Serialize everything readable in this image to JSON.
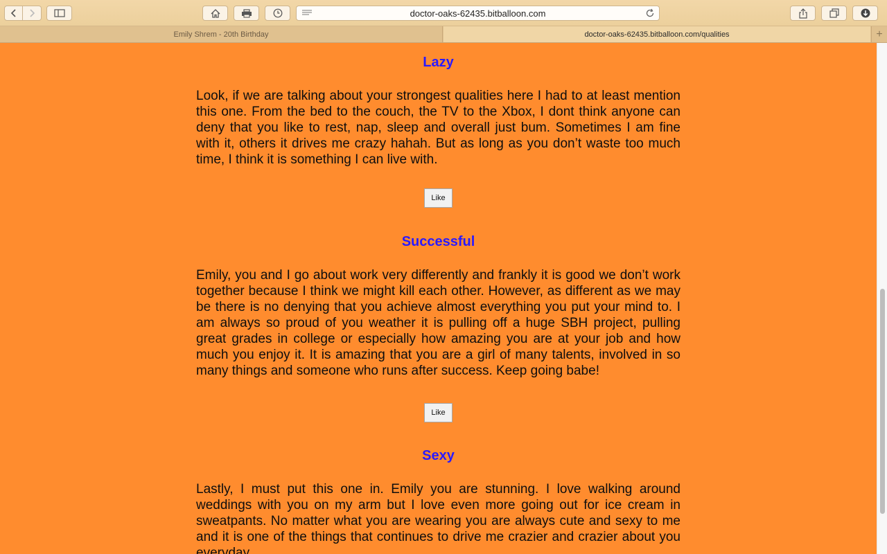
{
  "browser": {
    "url": "doctor-oaks-62435.bitballoon.com",
    "tabs": [
      {
        "label": "Emily Shrem - 20th Birthday"
      },
      {
        "label": "doctor-oaks-62435.bitballoon.com/qualities"
      }
    ],
    "new_tab": "+"
  },
  "sections": [
    {
      "title": "Lazy",
      "body": "Look, if we are talking about your strongest qualities here I had to at least mention this one. From the bed to the couch, the TV to the Xbox, I dont think anyone can deny that you like to rest, nap, sleep and overall just bum. Sometimes I am fine with it, others it drives me crazy hahah. But as long as you don’t waste too much time, I think it is something I can live with.",
      "button": "Like"
    },
    {
      "title": "Successful",
      "body": "Emily, you and I go about work very differently and frankly it is good we don’t work together because I think we might kill each other. However, as different as we may be there is no denying that you achieve almost everything you put your mind to. I am always so proud of you weather it is pulling off a huge SBH project, pulling great grades in college or especially how amazing you are at your job and how much you enjoy it. It is amazing that you are a girl of many talents, involved in so many things and someone who runs after success. Keep going babe!",
      "button": "Like"
    },
    {
      "title": "Sexy",
      "body": "Lastly, I must put this one in. Emily you are stunning. I love walking around weddings with you on my arm but I love even more going out for ice cream in sweatpants. No matter what you are wearing you are always cute and sexy to me and it is one of the things that continues to drive me crazier and crazier about you everyday."
    }
  ],
  "colors": {
    "background": "#ff8c2e",
    "heading": "#2a1aff"
  }
}
